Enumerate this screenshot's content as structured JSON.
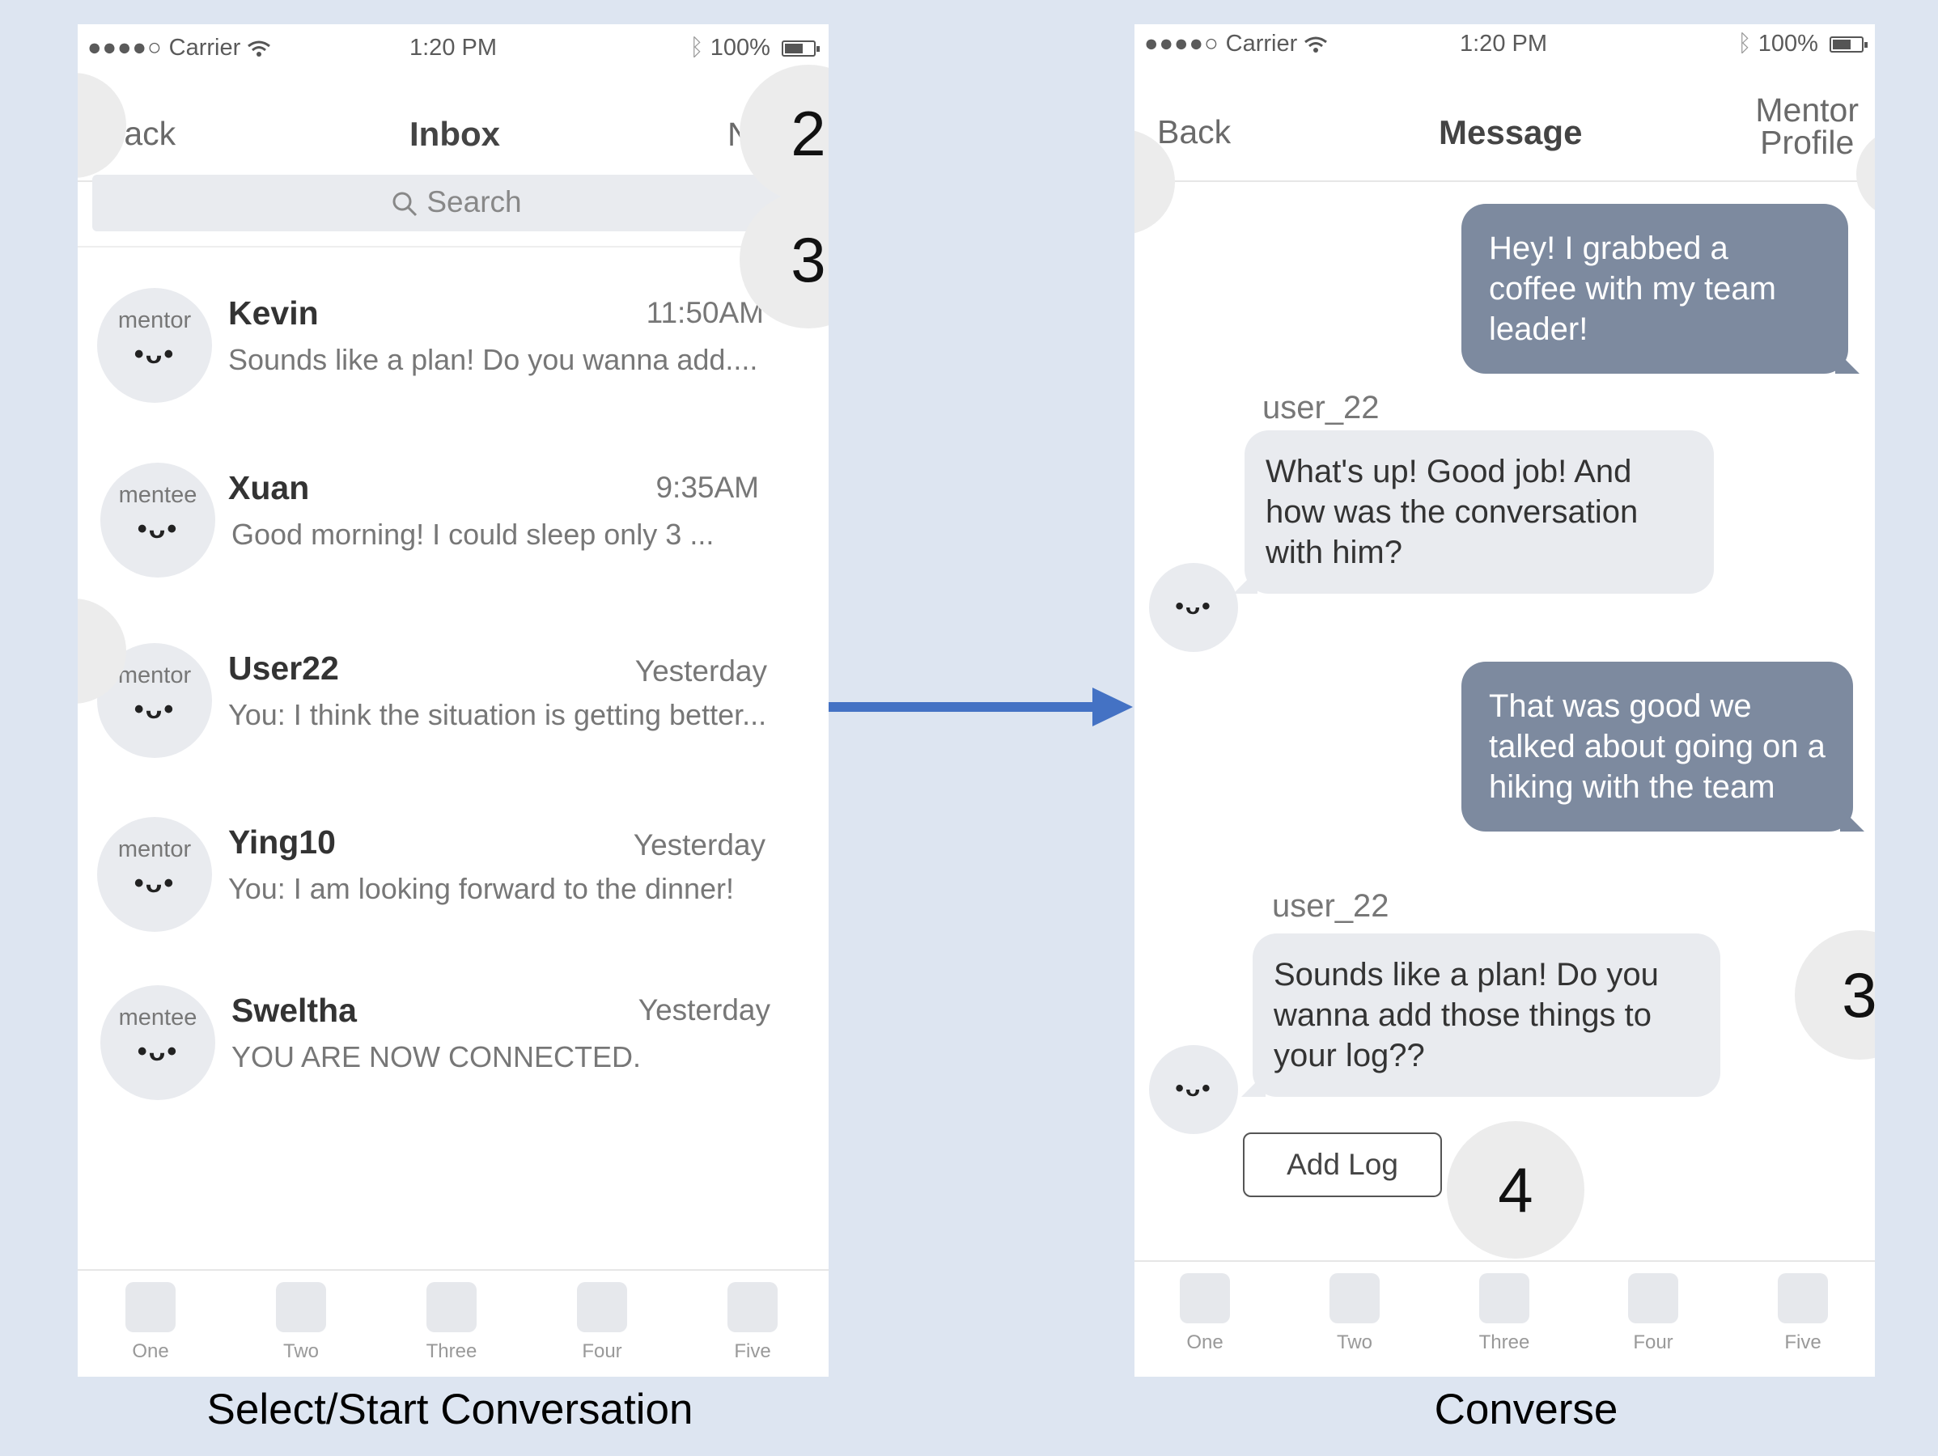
{
  "status": {
    "carrier": "Carrier",
    "time": "1:20 PM",
    "battery": "100%"
  },
  "inbox": {
    "back": "Back",
    "title": "Inbox",
    "right_partial": "N",
    "search_placeholder": "Search",
    "conversations": [
      {
        "role": "mentor",
        "name": "Kevin",
        "time": "11:50AM",
        "preview": "Sounds like a plan! Do you wanna add...."
      },
      {
        "role": "mentee",
        "name": "Xuan",
        "time": "9:35AM",
        "preview": "Good morning! I could sleep only 3 ..."
      },
      {
        "role": "mentor",
        "name": "User22",
        "time": "Yesterday",
        "preview": "You: I think the situation is getting better..."
      },
      {
        "role": "mentor",
        "name": "Ying10",
        "time": "Yesterday",
        "preview": "You: I am looking forward to the dinner!"
      },
      {
        "role": "mentee",
        "name": "Sweltha",
        "time": "Yesterday",
        "preview": "YOU ARE NOW CONNECTED."
      }
    ],
    "face": "•ᴗ•"
  },
  "message": {
    "back": "Back",
    "title": "Message",
    "right_line1": "Mentor",
    "right_line2": "Profile",
    "messages": [
      {
        "dir": "out",
        "text": "Hey! I grabbed a coffee with my team leader!"
      },
      {
        "dir": "in",
        "sender": "user_22",
        "text": "What's up! Good job! And how was the conversation with him?"
      },
      {
        "dir": "out",
        "text": "That was good we talked about going on a hiking with the team"
      },
      {
        "dir": "in",
        "sender": "user_22",
        "text": "Sounds like a plan! Do you wanna add those things to your log??"
      }
    ],
    "add_log": "Add Log"
  },
  "tabs": [
    "One",
    "Two",
    "Three",
    "Four",
    "Five"
  ],
  "callouts": [
    "2",
    "3",
    "3",
    "4"
  ],
  "captions": {
    "left": "Select/Start Conversation",
    "right": "Converse"
  },
  "colors": {
    "background": "#dde5f1",
    "outgoing_bubble": "#7d8a9f",
    "incoming_bubble": "#e9ebef",
    "arrow": "#4472c4"
  },
  "icons": [
    "wifi-icon",
    "bluetooth-icon",
    "battery-icon",
    "search-icon",
    "arrow-right-icon"
  ]
}
